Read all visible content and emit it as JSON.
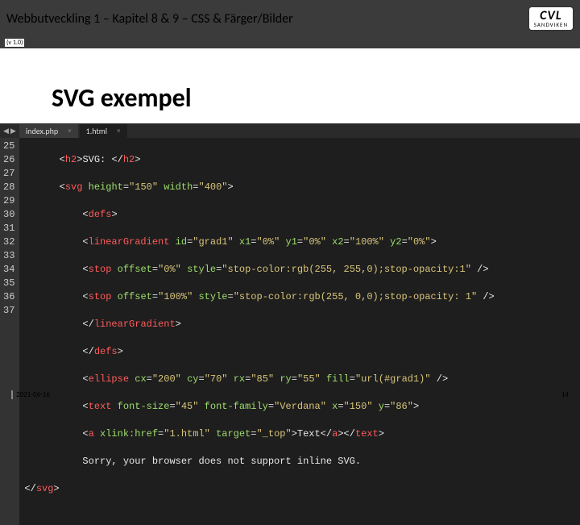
{
  "header": {
    "title": "Webbutveckling 1  – Kapitel 8 & 9 – CSS & Färger/Bilder",
    "version": "(v 1.0)"
  },
  "logo": {
    "top": "CVL",
    "bottom": "SANDVIKEN"
  },
  "slide": {
    "title": "SVG exempel"
  },
  "editor": {
    "tabs": [
      {
        "label": "index.php",
        "active": false
      },
      {
        "label": "1.html",
        "active": true
      }
    ],
    "line_start": 25,
    "line_end": 37,
    "code": {
      "l25": {
        "open": "<",
        "tag": "h2",
        "close1": ">",
        "text": "SVG: ",
        "open2": "</",
        "close2": ">"
      },
      "l26": {
        "open": "<",
        "tag": "svg",
        "a1": "height",
        "v1": "\"150\"",
        "a2": "width",
        "v2": "\"400\"",
        "close": ">"
      },
      "l27": {
        "open": "<",
        "tag": "defs",
        "close": ">"
      },
      "l28": {
        "open": "<",
        "tag": "linearGradient",
        "a1": "id",
        "v1": "\"grad1\"",
        "a2": "x1",
        "v2": "\"0%\"",
        "a3": "y1",
        "v3": "\"0%\"",
        "a4": "x2",
        "v4": "\"100%\"",
        "a5": "y2",
        "v5": "\"0%\"",
        "close": ">"
      },
      "l29": {
        "open": "<",
        "tag": "stop",
        "a1": "offset",
        "v1": "\"0%\"",
        "a2": "style",
        "v2": "\"stop-color:rgb(255, 255,0);stop-opacity:1\"",
        "close": " />"
      },
      "l30": {
        "open": "<",
        "tag": "stop",
        "a1": "offset",
        "v1": "\"100%\"",
        "a2": "style",
        "v2": "\"stop-color:rgb(255, 0,0);stop-opacity: 1\"",
        "close": " />"
      },
      "l31": {
        "open": "</",
        "tag": "linearGradient",
        "close": ">"
      },
      "l32": {
        "open": "</",
        "tag": "defs",
        "close": ">"
      },
      "l33": {
        "open": "<",
        "tag": "ellipse",
        "a1": "cx",
        "v1": "\"200\"",
        "a2": "cy",
        "v2": "\"70\"",
        "a3": "rx",
        "v3": "\"85\"",
        "a4": "ry",
        "v4": "\"55\"",
        "a5": "fill",
        "v5": "\"url(#grad1)\"",
        "close": " />"
      },
      "l34": {
        "open": "<",
        "tag": "text",
        "a1": "font-size",
        "v1": "\"45\"",
        "a2": "font-family",
        "v2": "\"Verdana\"",
        "a3": "x",
        "v3": "\"150\"",
        "a4": "y",
        "v4": "\"86\"",
        "close": ">"
      },
      "l35": {
        "open": "<",
        "tag": "a",
        "a1": "xlink:href",
        "v1": "\"1.html\"",
        "a2": "target",
        "v2": "\"_top\"",
        "mid": ">",
        "text": "Text",
        "open2": "</",
        "tag2": "a",
        "close2": "></",
        "tag3": "text",
        "close3": ">"
      },
      "l36": {
        "text": "Sorry, your browser does not support inline SVG."
      },
      "l37": {
        "open": "</",
        "tag": "svg",
        "close": ">"
      }
    }
  },
  "footer": {
    "date": "2021-06-16",
    "page": "14"
  }
}
